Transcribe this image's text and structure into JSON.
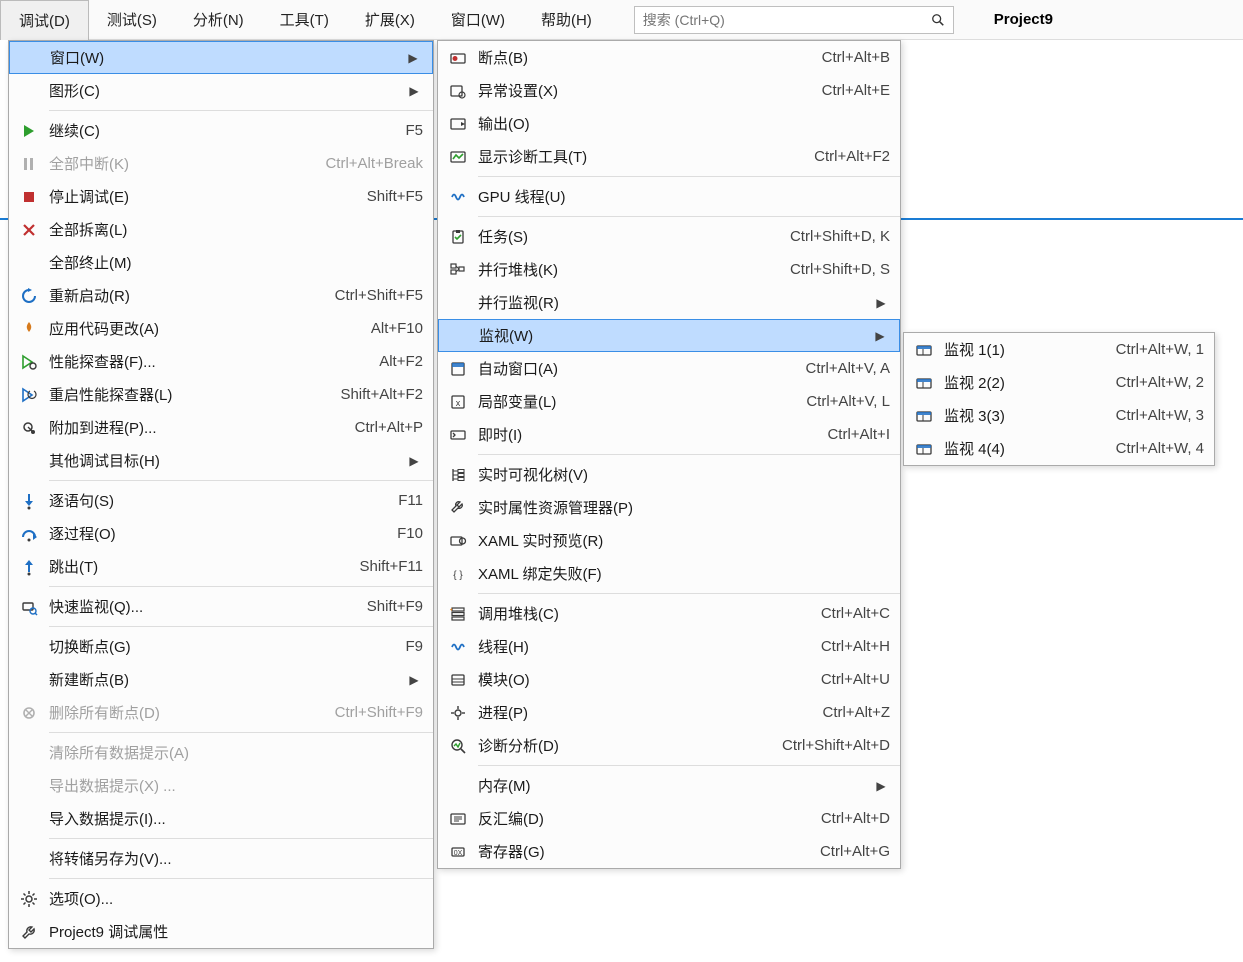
{
  "menubar": {
    "items": [
      {
        "label": "调试(D)",
        "active": true
      },
      {
        "label": "测试(S)"
      },
      {
        "label": "分析(N)"
      },
      {
        "label": "工具(T)"
      },
      {
        "label": "扩展(X)"
      },
      {
        "label": "窗口(W)"
      },
      {
        "label": "帮助(H)"
      }
    ],
    "search_placeholder": "搜索 (Ctrl+Q)",
    "project": "Project9"
  },
  "menu1": [
    {
      "type": "item",
      "icon": "",
      "label": "窗口(W)",
      "shortcut": "",
      "submenu": true,
      "highlight": true
    },
    {
      "type": "item",
      "icon": "",
      "label": "图形(C)",
      "shortcut": "",
      "submenu": true
    },
    {
      "type": "sep"
    },
    {
      "type": "item",
      "icon": "continue",
      "label": "继续(C)",
      "shortcut": "F5"
    },
    {
      "type": "item",
      "icon": "pause",
      "label": "全部中断(K)",
      "shortcut": "Ctrl+Alt+Break",
      "disabled": true
    },
    {
      "type": "item",
      "icon": "stop",
      "label": "停止调试(E)",
      "shortcut": "Shift+F5"
    },
    {
      "type": "item",
      "icon": "detach",
      "label": "全部拆离(L)",
      "shortcut": ""
    },
    {
      "type": "item",
      "icon": "",
      "label": "全部终止(M)",
      "shortcut": ""
    },
    {
      "type": "item",
      "icon": "restart",
      "label": "重新启动(R)",
      "shortcut": "Ctrl+Shift+F5"
    },
    {
      "type": "item",
      "icon": "apply",
      "label": "应用代码更改(A)",
      "shortcut": "Alt+F10"
    },
    {
      "type": "item",
      "icon": "perf",
      "label": "性能探查器(F)...",
      "shortcut": "Alt+F2"
    },
    {
      "type": "item",
      "icon": "reperf",
      "label": "重启性能探查器(L)",
      "shortcut": "Shift+Alt+F2"
    },
    {
      "type": "item",
      "icon": "attach",
      "label": "附加到进程(P)...",
      "shortcut": "Ctrl+Alt+P"
    },
    {
      "type": "item",
      "icon": "",
      "label": "其他调试目标(H)",
      "shortcut": "",
      "submenu": true
    },
    {
      "type": "sep"
    },
    {
      "type": "item",
      "icon": "stepinto",
      "label": "逐语句(S)",
      "shortcut": "F11"
    },
    {
      "type": "item",
      "icon": "stepover",
      "label": "逐过程(O)",
      "shortcut": "F10"
    },
    {
      "type": "item",
      "icon": "stepout",
      "label": "跳出(T)",
      "shortcut": "Shift+F11"
    },
    {
      "type": "sep"
    },
    {
      "type": "item",
      "icon": "quickwatch",
      "label": "快速监视(Q)...",
      "shortcut": "Shift+F9"
    },
    {
      "type": "sep"
    },
    {
      "type": "item",
      "icon": "",
      "label": "切换断点(G)",
      "shortcut": "F9"
    },
    {
      "type": "item",
      "icon": "",
      "label": "新建断点(B)",
      "shortcut": "",
      "submenu": true
    },
    {
      "type": "item",
      "icon": "delbp",
      "label": "删除所有断点(D)",
      "shortcut": "Ctrl+Shift+F9",
      "disabled": true
    },
    {
      "type": "sep"
    },
    {
      "type": "item",
      "icon": "",
      "label": "清除所有数据提示(A)",
      "shortcut": "",
      "disabled": true
    },
    {
      "type": "item",
      "icon": "",
      "label": "导出数据提示(X) ...",
      "shortcut": "",
      "disabled": true
    },
    {
      "type": "item",
      "icon": "",
      "label": "导入数据提示(I)...",
      "shortcut": ""
    },
    {
      "type": "sep"
    },
    {
      "type": "item",
      "icon": "",
      "label": "将转储另存为(V)...",
      "shortcut": ""
    },
    {
      "type": "sep"
    },
    {
      "type": "item",
      "icon": "gear",
      "label": "选项(O)...",
      "shortcut": ""
    },
    {
      "type": "item",
      "icon": "wrench",
      "label": "Project9 调试属性",
      "shortcut": ""
    }
  ],
  "menu2": [
    {
      "type": "item",
      "icon": "bp",
      "label": "断点(B)",
      "shortcut": "Ctrl+Alt+B"
    },
    {
      "type": "item",
      "icon": "excset",
      "label": "异常设置(X)",
      "shortcut": "Ctrl+Alt+E"
    },
    {
      "type": "item",
      "icon": "output",
      "label": "输出(O)",
      "shortcut": ""
    },
    {
      "type": "item",
      "icon": "diagtool",
      "label": "显示诊断工具(T)",
      "shortcut": "Ctrl+Alt+F2"
    },
    {
      "type": "sep"
    },
    {
      "type": "item",
      "icon": "gputhread",
      "label": "GPU 线程(U)",
      "shortcut": ""
    },
    {
      "type": "sep"
    },
    {
      "type": "item",
      "icon": "tasks",
      "label": "任务(S)",
      "shortcut": "Ctrl+Shift+D, K"
    },
    {
      "type": "item",
      "icon": "parstack",
      "label": "并行堆栈(K)",
      "shortcut": "Ctrl+Shift+D, S"
    },
    {
      "type": "item",
      "icon": "",
      "label": "并行监视(R)",
      "shortcut": "",
      "submenu": true
    },
    {
      "type": "item",
      "icon": "",
      "label": "监视(W)",
      "shortcut": "",
      "submenu": true,
      "highlight": true
    },
    {
      "type": "item",
      "icon": "autos",
      "label": "自动窗口(A)",
      "shortcut": "Ctrl+Alt+V, A"
    },
    {
      "type": "item",
      "icon": "locals",
      "label": "局部变量(L)",
      "shortcut": "Ctrl+Alt+V, L"
    },
    {
      "type": "item",
      "icon": "immediate",
      "label": "即时(I)",
      "shortcut": "Ctrl+Alt+I"
    },
    {
      "type": "sep"
    },
    {
      "type": "item",
      "icon": "livetree",
      "label": "实时可视化树(V)",
      "shortcut": ""
    },
    {
      "type": "item",
      "icon": "liveprop",
      "label": "实时属性资源管理器(P)",
      "shortcut": ""
    },
    {
      "type": "item",
      "icon": "xamlprev",
      "label": "XAML 实时预览(R)",
      "shortcut": ""
    },
    {
      "type": "item",
      "icon": "xamlbind",
      "label": "XAML 绑定失败(F)",
      "shortcut": ""
    },
    {
      "type": "sep"
    },
    {
      "type": "item",
      "icon": "callstack",
      "label": "调用堆栈(C)",
      "shortcut": "Ctrl+Alt+C"
    },
    {
      "type": "item",
      "icon": "threads",
      "label": "线程(H)",
      "shortcut": "Ctrl+Alt+H"
    },
    {
      "type": "item",
      "icon": "modules",
      "label": "模块(O)",
      "shortcut": "Ctrl+Alt+U"
    },
    {
      "type": "item",
      "icon": "processes",
      "label": "进程(P)",
      "shortcut": "Ctrl+Alt+Z"
    },
    {
      "type": "item",
      "icon": "diaganly",
      "label": "诊断分析(D)",
      "shortcut": "Ctrl+Shift+Alt+D"
    },
    {
      "type": "sep"
    },
    {
      "type": "item",
      "icon": "",
      "label": "内存(M)",
      "shortcut": "",
      "submenu": true
    },
    {
      "type": "item",
      "icon": "disasm",
      "label": "反汇编(D)",
      "shortcut": "Ctrl+Alt+D"
    },
    {
      "type": "item",
      "icon": "registers",
      "label": "寄存器(G)",
      "shortcut": "Ctrl+Alt+G"
    }
  ],
  "menu3": [
    {
      "type": "item",
      "icon": "watch",
      "label": "监视 1(1)",
      "shortcut": "Ctrl+Alt+W, 1"
    },
    {
      "type": "item",
      "icon": "watch",
      "label": "监视 2(2)",
      "shortcut": "Ctrl+Alt+W, 2"
    },
    {
      "type": "item",
      "icon": "watch",
      "label": "监视 3(3)",
      "shortcut": "Ctrl+Alt+W, 3"
    },
    {
      "type": "item",
      "icon": "watch",
      "label": "监视 4(4)",
      "shortcut": "Ctrl+Alt+W, 4"
    }
  ]
}
